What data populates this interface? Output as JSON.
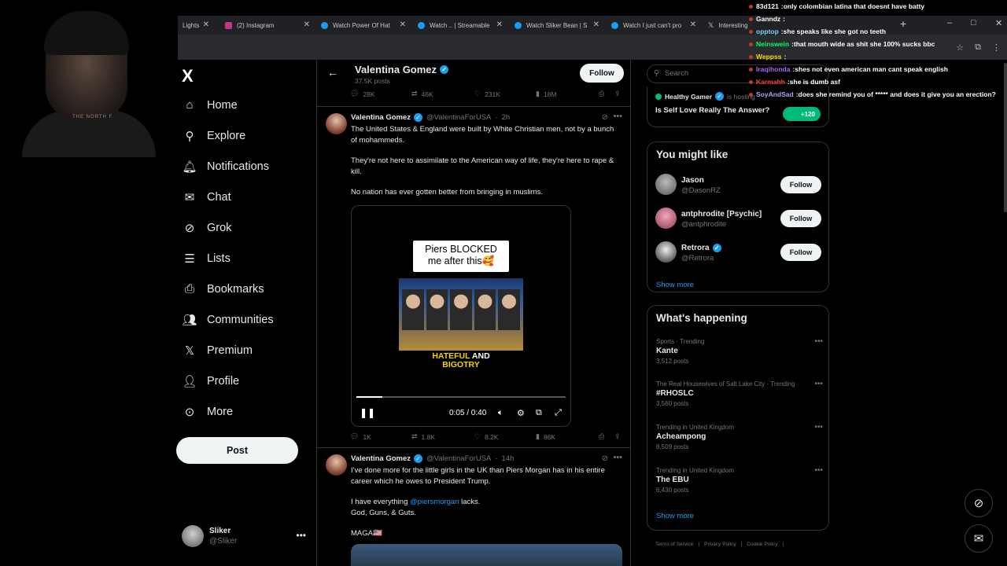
{
  "browser": {
    "tabs": [
      {
        "title": "Lights",
        "icon": "page-icon"
      },
      {
        "title": "(2) Instagram",
        "icon": "instagram-icon"
      },
      {
        "title": "Watch Power Of Hat",
        "icon": "streamable-icon"
      },
      {
        "title": "Watch .. | Streamable",
        "icon": "streamable-icon"
      },
      {
        "title": "Watch Sliker Bean | S",
        "icon": "streamable-icon"
      },
      {
        "title": "Watch I just can't pro",
        "icon": "streamable-icon"
      },
      {
        "title": "Interesting",
        "icon": "x-icon"
      }
    ],
    "new_tab": "+",
    "controls": {
      "minimize": "–",
      "maximize": "□",
      "close": "✕"
    }
  },
  "chat": [
    {
      "user": "83d121",
      "msg": "only colombian latina that doesnt have batty",
      "color": "#ffffff"
    },
    {
      "user": "Ganndz",
      "msg": "",
      "color": "#ffffff"
    },
    {
      "user": "opptop",
      "msg": "she speaks like she got no teeth",
      "color": "#7bd7ff"
    },
    {
      "user": "Neinswein",
      "msg": "that mouth wide as shit she 100% sucks bbc",
      "color": "#00ff66"
    },
    {
      "user": "Weppss",
      "msg": "",
      "color": "#ffd400"
    },
    {
      "user": "Iraqihonda",
      "msg": "shes not even american man cant speak english",
      "color": "#b063ff"
    },
    {
      "user": "Karmahh",
      "msg": "she is dumb asf",
      "color": "#ff3b3b"
    },
    {
      "user": "SoyAndSad",
      "msg": "does she remind you of ***** and does it give you an erection?",
      "color": "#b89bff"
    }
  ],
  "webcam_shirt_text": "THE NORTH F",
  "nav": {
    "logo": "X",
    "items": [
      {
        "label": "Home",
        "icon": "home-icon",
        "glyph": "⌂"
      },
      {
        "label": "Explore",
        "icon": "search-icon",
        "glyph": "⚲"
      },
      {
        "label": "Notifications",
        "icon": "bell-icon",
        "glyph": "🔔︎"
      },
      {
        "label": "Chat",
        "icon": "mail-icon",
        "glyph": "✉"
      },
      {
        "label": "Grok",
        "icon": "grok-icon",
        "glyph": "⊘"
      },
      {
        "label": "Lists",
        "icon": "list-icon",
        "glyph": "☰"
      },
      {
        "label": "Bookmarks",
        "icon": "bookmark-icon",
        "glyph": "⎙"
      },
      {
        "label": "Communities",
        "icon": "communities-icon",
        "glyph": "👥︎"
      },
      {
        "label": "Premium",
        "icon": "x-icon",
        "glyph": "𝕏"
      },
      {
        "label": "Profile",
        "icon": "user-icon",
        "glyph": "👤︎"
      },
      {
        "label": "More",
        "icon": "more-circle-icon",
        "glyph": "⊙"
      }
    ],
    "post_label": "Post",
    "account": {
      "name": "Sliker",
      "handle": "@Sliker"
    }
  },
  "profile": {
    "name": "Valentina Gomez",
    "posts": "37.5K posts",
    "follow_label": "Follow"
  },
  "top_actions": {
    "replies": "28K",
    "reposts": "46K",
    "likes": "231K",
    "views": "18M"
  },
  "tweet1": {
    "name": "Valentina Gomez",
    "handle": "@ValentinaForUSA",
    "time": "2h",
    "paragraphs": [
      "The United States & England were built by White Christian men, not by a bunch of mohammeds.",
      "They're not here to assimilate to the American way of life, they're here to rape & kill.",
      "No nation has ever gotten better from bringing in muslims."
    ],
    "video": {
      "caption_line1": "Piers BLOCKED",
      "caption_line2": "me after this🥰",
      "overlay_word1": "HATEFUL",
      "overlay_word2": "AND",
      "overlay_word3": "BIGOTRY",
      "time": "0:05 / 0:40",
      "progress": 0.125
    },
    "actions": {
      "replies": "1K",
      "reposts": "1.8K",
      "likes": "8.2K",
      "views": "86K"
    }
  },
  "tweet2": {
    "name": "Valentina Gomez",
    "handle": "@ValentinaForUSA",
    "time": "14h",
    "p1": "I've done more for the little girls in the UK than Piers Morgan has in his entire career which he owes to President Trump.",
    "p2_pre": "I have everything ",
    "p2_mention": "@piersmorgan",
    "p2_post": " lacks.",
    "p3": "God, Guns, & Guts.",
    "p4": "MAGA🇺🇸"
  },
  "search": {
    "placeholder": "Search"
  },
  "live": {
    "host": "Healthy Gamer",
    "status": "is hosting",
    "title": "Is Self Love Really The Answer?",
    "count": "+120"
  },
  "who_to_follow": {
    "title": "You might like",
    "items": [
      {
        "name": "Jason",
        "handle": "@DasonRZ",
        "verified": false
      },
      {
        "name": "antphrodite [Psychic]",
        "handle": "@antphrodite",
        "verified": false
      },
      {
        "name": "Retrora",
        "handle": "@Retrora",
        "verified": true
      }
    ],
    "follow_label": "Follow",
    "show_more": "Show more"
  },
  "trends": {
    "title": "What's happening",
    "items": [
      {
        "context": "Sports · Trending",
        "name": "Kante",
        "count": "3,512 posts"
      },
      {
        "context": "The Real Housewives of Salt Lake City · Trending",
        "name": "#RHOSLC",
        "count": "3,560 posts"
      },
      {
        "context": "Trending in United Kingdom",
        "name": "Acheampong",
        "count": "8,509 posts"
      },
      {
        "context": "Trending in United Kingdom",
        "name": "The EBU",
        "count": "6,430 posts"
      }
    ],
    "show_more": "Show more"
  },
  "footer": [
    "Terms of Service",
    "Privacy Policy",
    "Cookie Policy"
  ],
  "colors": {
    "accent": "#1d9bf0",
    "background": "#000000",
    "border": "#2f3336",
    "muted": "#71767b"
  }
}
